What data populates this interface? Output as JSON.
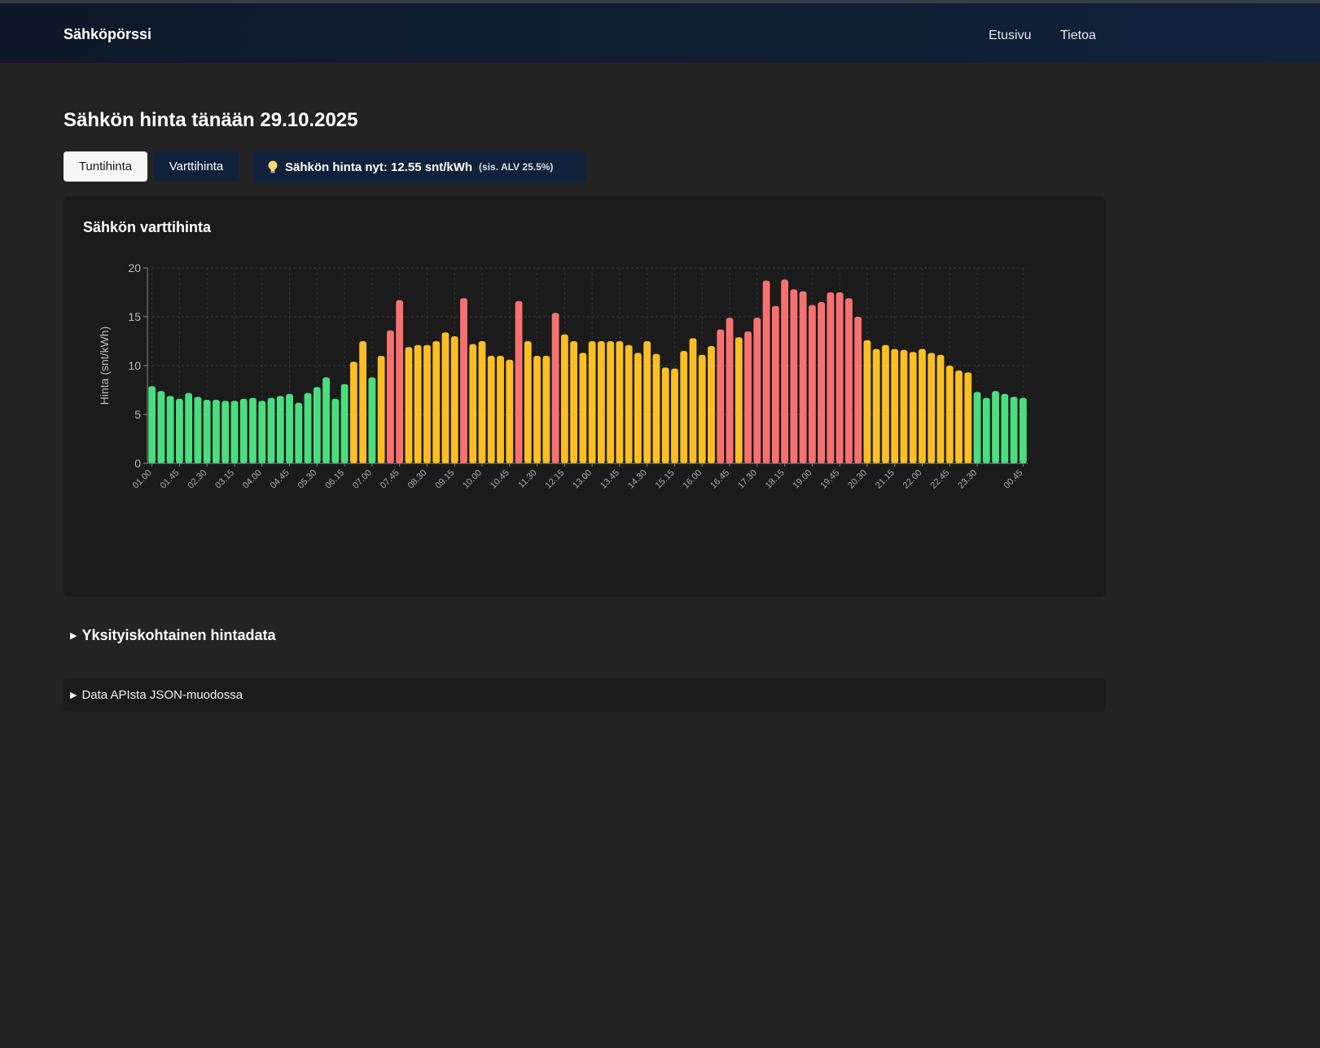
{
  "app": {
    "brand": "Sähköpörssi"
  },
  "nav": {
    "items": [
      "Etusivu",
      "Tietoa"
    ]
  },
  "page": {
    "title": "Sähkön hinta tänään 29.10.2025"
  },
  "toggle": {
    "tunti": "Tuntihinta",
    "vartti": "Varttihinta",
    "active": "Tuntihinta"
  },
  "price_now": {
    "label": "Sähkön hinta nyt: 12.55 snt/kWh",
    "vat": "(sis. ALV 25.5%)",
    "icon": "lightbulb-icon"
  },
  "chart_card": {
    "title": "Sähkön varttihinta"
  },
  "details": {
    "label": "Yksityiskohtainen hintadata"
  },
  "json_section": {
    "label": "Data APIsta JSON-muodossa"
  },
  "colors": {
    "low": "#4ade80",
    "mid": "#fbbf24",
    "high": "#f87171",
    "navbar": "#0e1828",
    "button_dark": "#10223b"
  },
  "chart_data": {
    "type": "bar",
    "title": "Sähkön varttihinta",
    "ylabel": "Hinta (snt/kWh)",
    "xlabel": "",
    "ylim": [
      0,
      20
    ],
    "yticks": [
      0,
      5,
      10,
      15,
      20
    ],
    "grid": true,
    "x_tick_labels": [
      "01.00",
      "01.45",
      "02.30",
      "03.15",
      "04.00",
      "04.45",
      "05.30",
      "06.15",
      "07.00",
      "07.45",
      "08.30",
      "09.15",
      "10.00",
      "10.45",
      "11.30",
      "12.15",
      "13.00",
      "13.45",
      "14.30",
      "15.15",
      "16.00",
      "16.45",
      "17.30",
      "18.15",
      "19.00",
      "19.45",
      "20.30",
      "21.15",
      "22.00",
      "22.45",
      "23.30",
      "00.45"
    ],
    "x_tick_indices": [
      0,
      3,
      6,
      9,
      12,
      15,
      18,
      21,
      24,
      27,
      30,
      33,
      36,
      39,
      42,
      45,
      48,
      51,
      54,
      57,
      60,
      63,
      66,
      69,
      72,
      75,
      78,
      81,
      84,
      87,
      90,
      95
    ],
    "values": [
      7.9,
      7.4,
      6.9,
      6.6,
      7.2,
      6.8,
      6.5,
      6.5,
      6.4,
      6.4,
      6.6,
      6.7,
      6.4,
      6.7,
      6.9,
      7.1,
      6.2,
      7.2,
      7.8,
      8.8,
      6.6,
      8.1,
      10.4,
      12.5,
      8.8,
      11.0,
      13.6,
      16.7,
      11.9,
      12.1,
      12.1,
      12.5,
      13.4,
      13.0,
      16.9,
      12.2,
      12.5,
      11.0,
      11.0,
      10.6,
      16.6,
      12.5,
      11.0,
      11.0,
      15.4,
      13.2,
      12.5,
      11.3,
      12.5,
      12.5,
      12.5,
      12.5,
      12.1,
      11.3,
      12.5,
      11.2,
      9.8,
      9.7,
      11.5,
      12.8,
      11.1,
      12.0,
      13.7,
      14.9,
      12.9,
      13.5,
      14.9,
      18.7,
      16.1,
      18.8,
      17.8,
      17.6,
      16.2,
      16.5,
      17.5,
      17.5,
      16.9,
      15.0,
      12.6,
      11.7,
      12.1,
      11.7,
      11.6,
      11.4,
      11.7,
      11.3,
      11.1,
      10.0,
      9.5,
      9.3,
      7.3,
      6.7,
      7.4,
      7.1,
      6.8,
      6.7
    ],
    "categories": [
      "mid",
      "high",
      "mid",
      "high",
      "mid",
      "high",
      "mid",
      "high",
      "mid",
      "high",
      "mid",
      "high",
      "mid",
      "high",
      "mid",
      "high"
    ]
  }
}
